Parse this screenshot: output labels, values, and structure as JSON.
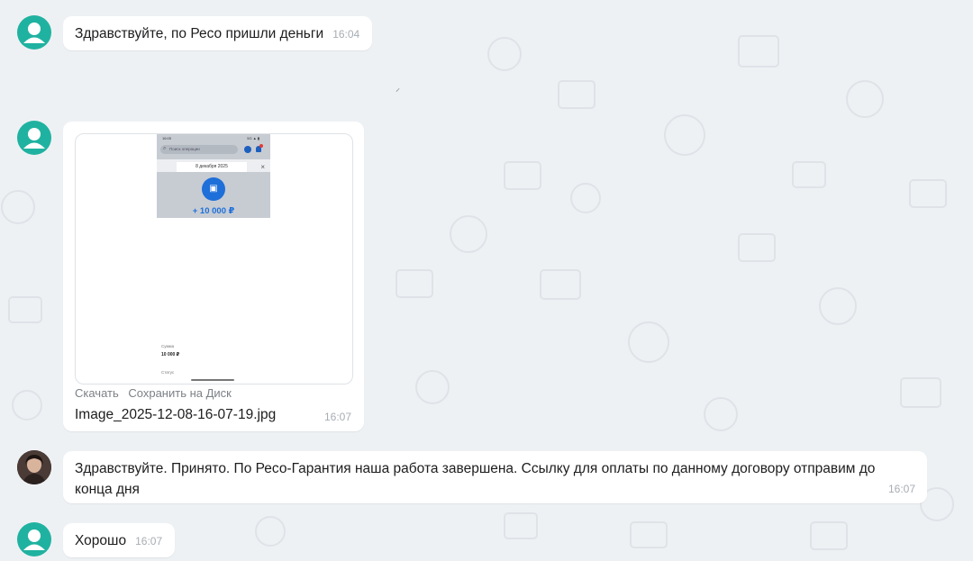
{
  "colors": {
    "background": "#eef1f4",
    "bubble": "#ffffff",
    "avatar_teal": "#20b2a0",
    "accent_blue": "#1e6fd9"
  },
  "messages": [
    {
      "text": "Здравствуйте, по Ресо пришли деньги",
      "time": "16:04"
    },
    {
      "time": "16:07",
      "attachment": {
        "file_name": "Image_2025-12-08-16-07-19.jpg",
        "download_label": "Скачать",
        "save_label": "Сохранить на Диск",
        "preview": {
          "status_time": "16:05",
          "status_icons": "5G ▲ ▮",
          "search_placeholder": "Поиск операции",
          "date": "8 декабря 2025",
          "close_glyph": "×",
          "amount": "+ 10 000 ₽",
          "sum_label": "Сумма",
          "sum_value": "10 000 ₽",
          "status_label": "Статус"
        }
      }
    },
    {
      "text": "Здравствуйте. Принято. По Ресо-Гарантия наша работа завершена. Ссылку для оплаты по данному договору отправим до конца дня",
      "time": "16:07"
    },
    {
      "text": "Хорошо",
      "time": "16:07"
    }
  ],
  "icons": {
    "avatar_default": "user-silhouette-icon",
    "payment": "wallet-icon"
  }
}
